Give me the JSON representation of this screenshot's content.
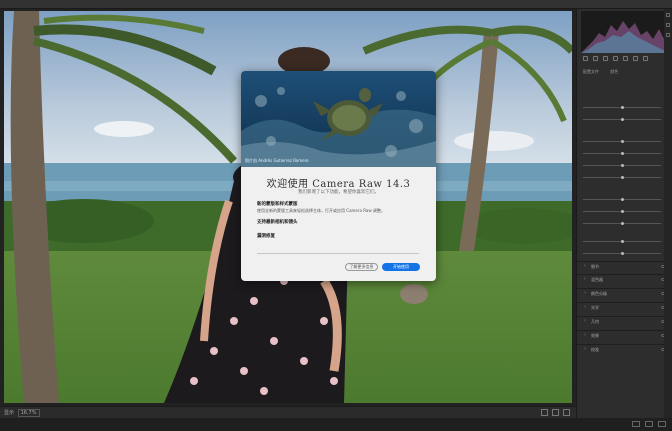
{
  "window": {
    "title": ""
  },
  "status": {
    "zoom_label": "显示",
    "zoom_value": "16.7%"
  },
  "panel": {
    "profile_label": "配置文件",
    "profile_value": "颜色",
    "sections": [
      {
        "label": "细节"
      },
      {
        "label": "混色器"
      },
      {
        "label": "颜色分级"
      },
      {
        "label": "光学"
      },
      {
        "label": "几何"
      },
      {
        "label": "效果"
      },
      {
        "label": "校准"
      }
    ]
  },
  "dialog": {
    "photo_credit": "照片由 Andrés Gutierrez Romero",
    "heading": "欢迎使用 Camera Raw 14.3",
    "subheading": "我们新增了以下功能，希望你喜欢它们。",
    "features": [
      {
        "title": "新的蒙版和样式蒙版",
        "desc": "使用全新的蒙版工具来轻松选择主体，打开或应用 Camera Raw 调整。"
      },
      {
        "title": "支持最新相机和镜头",
        "desc": ""
      },
      {
        "title": "漏洞修复",
        "desc": ""
      }
    ],
    "secondary_button": "了解更多信息",
    "primary_button": "开始使用"
  },
  "colors": {
    "accent": "#1473e6",
    "dialog_bg": "#f0f0f0",
    "panel_bg": "#2d2d2d"
  }
}
